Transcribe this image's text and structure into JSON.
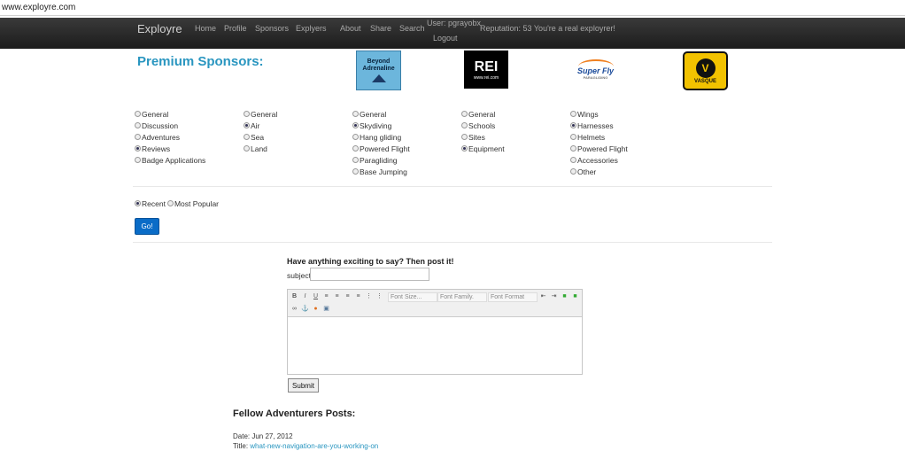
{
  "browser": {
    "url": "www.exployre.com"
  },
  "nav": {
    "brand": "Exployre",
    "items": [
      "Home",
      "Profile",
      "Sponsors",
      "Explyers",
      "About",
      "Share",
      "Search"
    ],
    "user": "User: pgrayobx",
    "logout": "Logout",
    "reputation": "Reputation: 53 You're a real exployrer!"
  },
  "sponsors": {
    "heading": "Premium Sponsors:",
    "logos": [
      {
        "name": "Beyond Adrenaline",
        "line1": "Beyond",
        "line2": "Adrenaline"
      },
      {
        "name": "REI",
        "text": "REI",
        "sub": "www.rei.com"
      },
      {
        "name": "Super Fly",
        "text": "Super Fly",
        "sub": "PARAGLIDING"
      },
      {
        "name": "Vasque",
        "mark": "V",
        "text": "VASQUE"
      }
    ]
  },
  "filters": {
    "col1": [
      {
        "label": "General",
        "checked": false
      },
      {
        "label": "Discussion",
        "checked": false
      },
      {
        "label": "Adventures",
        "checked": false
      },
      {
        "label": " Reviews",
        "checked": true
      },
      {
        "label": "Badge Applications",
        "checked": false
      }
    ],
    "col2": [
      {
        "label": "General",
        "checked": false
      },
      {
        "label": "Air",
        "checked": true
      },
      {
        "label": "Sea",
        "checked": false
      },
      {
        "label": "Land",
        "checked": false
      }
    ],
    "col3": [
      {
        "label": "General",
        "checked": false
      },
      {
        "label": "Skydiving",
        "checked": true
      },
      {
        "label": "Hang gliding",
        "checked": false
      },
      {
        "label": "Powered Flight",
        "checked": false
      },
      {
        "label": "Paragliding",
        "checked": false
      },
      {
        "label": "Base Jumping",
        "checked": false
      }
    ],
    "col4": [
      {
        "label": "General",
        "checked": false
      },
      {
        "label": "Schools",
        "checked": false
      },
      {
        "label": "Sites",
        "checked": false
      },
      {
        "label": "Equipment",
        "checked": true
      }
    ],
    "col5": [
      {
        "label": "Wings",
        "checked": false
      },
      {
        "label": "Harnesses",
        "checked": true
      },
      {
        "label": "Helmets",
        "checked": false
      },
      {
        "label": "Powered Flight",
        "checked": false
      },
      {
        "label": "Accessories",
        "checked": false
      },
      {
        "label": "Other",
        "checked": false
      }
    ]
  },
  "sort": {
    "recent": "Recent",
    "recent_checked": true,
    "popular": "Most Popular",
    "popular_checked": false,
    "go": "Go!"
  },
  "post": {
    "heading": "Have anything exciting to say? Then post it!",
    "subject_label": "subject",
    "subject_value": "",
    "font_size": "Font Size...",
    "font_family": "Font Family.",
    "font_format": "Font Format",
    "submit": "Submit"
  },
  "feed": {
    "heading": "Fellow Adventurers Posts:",
    "date": "Date: Jun 27, 2012",
    "title_label": "Title: ",
    "title_link": "what-new-navigation-are-you-working-on"
  }
}
